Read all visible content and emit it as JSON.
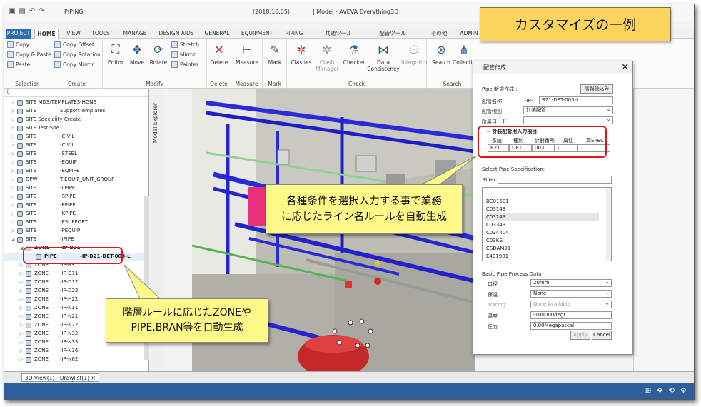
{
  "titlebar": {
    "file_name": "PIPING",
    "date": "(2018.10.05)",
    "window_title": "| Model - AVEVA Everything3D"
  },
  "tabs": [
    "PROJECT",
    "HOME",
    "VIEW",
    "TOOLS",
    "MANAGE",
    "DESIGN AIDS",
    "GENERAL",
    "EQUIPMENT",
    "PIPING",
    "共通ツール",
    "配管ツール",
    "その他",
    "ADMIN"
  ],
  "ribbon": {
    "selection": {
      "copy": "Copy",
      "copy_paste": "Copy & Paste",
      "paste": "Paste",
      "label": "Selection"
    },
    "create": {
      "copy_offset": "Copy Offset",
      "copy_rotation": "Copy Rotation",
      "copy_mirror": "Copy Mirror",
      "label": "Create"
    },
    "modify": {
      "editor": "Editor",
      "move": "Move",
      "rotate": "Rotate",
      "stretch": "Stretch",
      "mirror": "Mirror",
      "painter": "Painter",
      "label": "Modify"
    },
    "delete": {
      "btn": "Delete",
      "label": "Delete"
    },
    "measure": {
      "btn": "Measure",
      "label": "Measure"
    },
    "mark": {
      "btn": "Mark",
      "label": "Mark"
    },
    "check": {
      "clashes": "Clashes",
      "clash_manager": "Clash Manager",
      "checker": "Checker",
      "data_consistency": "Data Consistency",
      "integrator": "Integrator",
      "label": "Check"
    },
    "search": {
      "search": "Search",
      "collection": "Collectio",
      "label": "Search"
    }
  },
  "tree": {
    "rows": [
      {
        "arrow": "▷",
        "k": "SITE MDS/TEMPLATES-HGNE",
        "v": ""
      },
      {
        "arrow": "▷",
        "k": "SITE",
        "v": "SupportTemplates"
      },
      {
        "arrow": "▷",
        "k": "SITE Speciality-Create",
        "v": ""
      },
      {
        "arrow": "▷",
        "k": "SITE Test-Site",
        "v": ""
      },
      {
        "arrow": "▷",
        "k": "SITE",
        "v": "-CIVIL"
      },
      {
        "arrow": "▷",
        "k": "SITE",
        "v": "-CIVIL"
      },
      {
        "arrow": "▷",
        "k": "SITE",
        "v": "-STEEL"
      },
      {
        "arrow": "▷",
        "k": "SITE",
        "v": "-EQUIP"
      },
      {
        "arrow": "▷",
        "k": "SITE",
        "v": "-EQPIPE"
      },
      {
        "arrow": "▷",
        "k": "GPW",
        "v": "T-EQUIP_UNIT_GROUP"
      },
      {
        "arrow": "▷",
        "k": "SITE",
        "v": "-LPIPE"
      },
      {
        "arrow": "▷",
        "k": "SITE",
        "v": "-SPIPE"
      },
      {
        "arrow": "▷",
        "k": "SITE",
        "v": "-PPIPE"
      },
      {
        "arrow": "▷",
        "k": "SITE",
        "v": "-KPIPE"
      },
      {
        "arrow": "▷",
        "k": "SITE",
        "v": "-PSUPPORT"
      },
      {
        "arrow": "▷",
        "k": "SITE",
        "v": "-PEQUIP"
      },
      {
        "arrow": "◢",
        "k": "SITE",
        "v": "-IPIPE"
      },
      {
        "arrow": "◢",
        "k": "ZONE",
        "v": "-IP-B21"
      },
      {
        "arrow": "",
        "k": "PIPE",
        "v": "-IP-B21-DET-003-L"
      },
      {
        "arrow": "▷",
        "k": "ZONE",
        "v": "-IP-B31"
      },
      {
        "arrow": "▷",
        "k": "ZONE",
        "v": "-IP-D11"
      },
      {
        "arrow": "▷",
        "k": "ZONE",
        "v": "-IP-D12"
      },
      {
        "arrow": "▷",
        "k": "ZONE",
        "v": "-IP-D22"
      },
      {
        "arrow": "▷",
        "k": "ZONE",
        "v": "-IP-H22"
      },
      {
        "arrow": "▷",
        "k": "ZONE",
        "v": "-IP-N11"
      },
      {
        "arrow": "▷",
        "k": "ZONE",
        "v": "-IP-N21"
      },
      {
        "arrow": "▷",
        "k": "ZONE",
        "v": "-IP-N22"
      },
      {
        "arrow": "▷",
        "k": "ZONE",
        "v": "-IP-N32"
      },
      {
        "arrow": "▷",
        "k": "ZONE",
        "v": "-IP-N33"
      },
      {
        "arrow": "▷",
        "k": "ZONE",
        "v": "-IP-N36"
      },
      {
        "arrow": "▷",
        "k": "ZONE",
        "v": "-IP-N62"
      }
    ]
  },
  "explorer_label": "Model Explorer",
  "bottom_tab": "3D View(1) - Drawlist(1)",
  "dialog": {
    "title": "配管作成",
    "section_new": "Pipe 新規作成 :",
    "info_btn": "情報読込み",
    "pipe_name_label": "配管名称",
    "pipe_name_prefix": "-IP-",
    "pipe_name_value": "B21-DET-003-L",
    "pipe_type_label": "配管種別",
    "pipe_type_value": "計装配管",
    "owner_label": "所属コード",
    "owner_value": "",
    "inst_header": "計装配管用入力項目",
    "inst_cols": [
      "系統",
      "種別",
      "計器番号",
      "属性",
      "真SPEC"
    ],
    "inst_vals": [
      "B21",
      "DET",
      "003",
      "L",
      ""
    ],
    "spec_label": "Select Pipe Specification:",
    "filter_label": "Filter",
    "filter_value": "",
    "specs": [
      "BC01501",
      "C03143",
      "C03243",
      "C03343",
      "C034404",
      "C03KEI",
      "CSDAM01",
      "E401901"
    ],
    "process_label": "Basic Pipe Process Data",
    "bore_label": "口径 :",
    "bore_value": "20mm",
    "insul_label": "保温 :",
    "insul_value": "None",
    "tracing_label": "Tracing:",
    "tracing_value": "None Available",
    "temp_label": "温度 :",
    "temp_value": "-100000degC",
    "press_label": "圧力 :",
    "press_value": "0.00Megapascal",
    "apply_btn": "Apply",
    "cancel_btn": "Cancel"
  },
  "annotations": {
    "top_badge": "カスタマイズの一例",
    "callout_right_line1": "各種条件を選択入力する事で業務",
    "callout_right_line2": "に応じたライン名ルールを自動生成",
    "callout_left_line1": "階層ルールに応じたZONEや",
    "callout_left_line2": "PIPE,BRAN等を自動生成"
  },
  "colors": {
    "accent": "#2f6db3",
    "statusbar": "#2d5f9e",
    "callout": "#fff98a",
    "badge": "#fcd45c",
    "highlight": "#e0141c"
  }
}
